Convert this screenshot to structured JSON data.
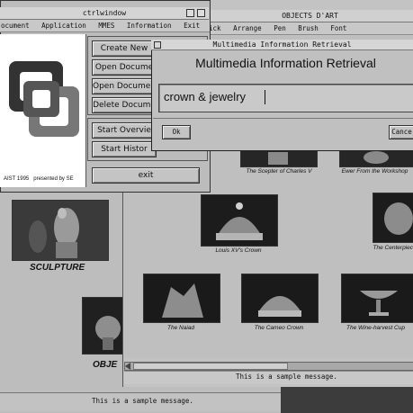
{
  "ctrl_window": {
    "title": "ctrlwindow",
    "menu": [
      "ocument",
      "Application",
      "MMES",
      "Information",
      "Exit"
    ],
    "buttons": {
      "create": "Create New",
      "open1": "Open Docume",
      "open2": "Open Documen",
      "delete": "Delete Docume",
      "start_overview": "Start Overvie",
      "start_history": "Start Histor",
      "exit": "exit"
    },
    "logo_caption": "AIST 1995   presented by SE"
  },
  "objects_window": {
    "title": "OBJECTS D'ART",
    "menu": [
      "ick",
      "Arrange",
      "Pen",
      "Brush",
      "Font"
    ],
    "items": [
      {
        "caption": "The Scepter of Charles V"
      },
      {
        "caption": "Ewer From the Workshop"
      },
      {
        "caption": "Louis XV's Crown"
      },
      {
        "caption": "The Centerpiec"
      },
      {
        "caption": "The Naiad"
      },
      {
        "caption": "The Cameo Crown"
      },
      {
        "caption": "The Wine-harvest Cup"
      }
    ],
    "status": "This is a sample message."
  },
  "background_window": {
    "sculpture_label": "SCULPTURE",
    "objects_label": "OBJE",
    "status": "This is a sample message."
  },
  "mir_dialog": {
    "title": "Multimedia Information Retrieval",
    "heading": "Multimedia Information Retrieval",
    "query": "crown & jewelry",
    "ok": "Ok",
    "cancel": "Cance"
  }
}
